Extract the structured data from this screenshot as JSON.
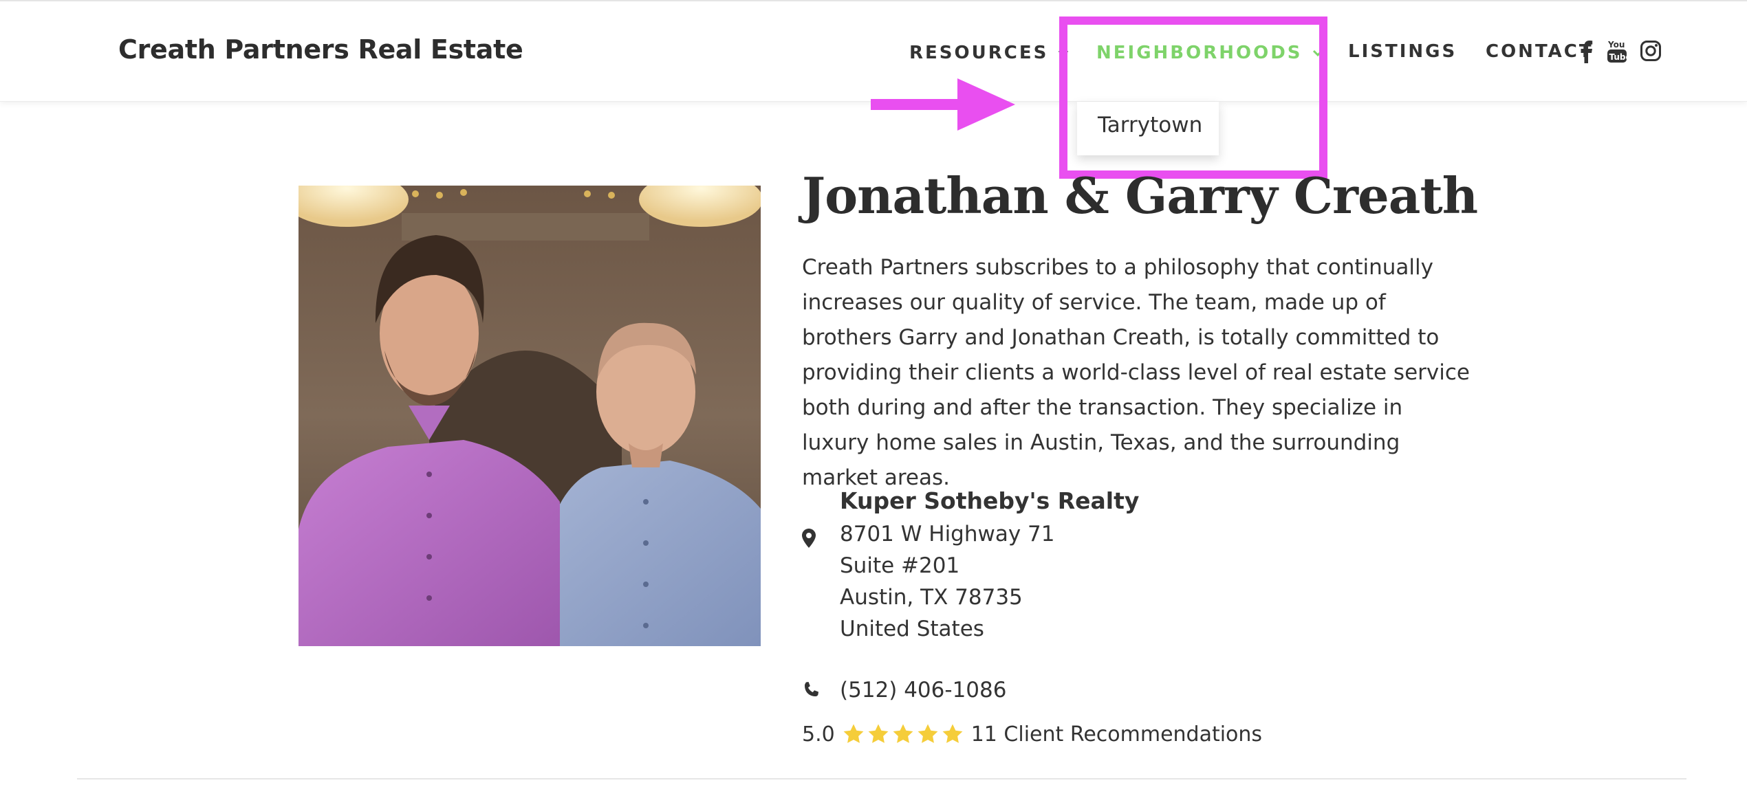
{
  "header": {
    "brand": "Creath Partners Real Estate",
    "nav": {
      "resources": "RESOURCES",
      "neighborhoods": "NEIGHBORHOODS",
      "listings": "LISTINGS",
      "contact": "CONTACT"
    },
    "social": [
      "facebook-icon",
      "youtube-icon",
      "instagram-icon"
    ]
  },
  "dropdown": {
    "items": [
      "Tarrytown"
    ]
  },
  "profile": {
    "name": "Jonathan & Garry Creath",
    "bio": "Creath Partners subscribes to a philosophy that continually increases our quality of service. The team, made up of brothers Garry and Jonathan Creath, is totally committed to providing their clients a world-class level of real estate service both during and after the transaction. They specialize in luxury home sales in Austin, Texas, and the surrounding market areas.",
    "office": {
      "company": "Kuper Sotheby's Realty",
      "address_lines": [
        "8701 W Highway 71",
        "Suite #201",
        "Austin, TX 78735",
        "United States"
      ]
    },
    "phone": "(512) 406-1086",
    "rating": {
      "score": "5.0",
      "stars": 5,
      "recommendations": "11 Client Recommendations"
    }
  },
  "colors": {
    "active_nav": "#7ed36a",
    "annotation": "#e94ff0",
    "star": "#f5cd3a"
  }
}
